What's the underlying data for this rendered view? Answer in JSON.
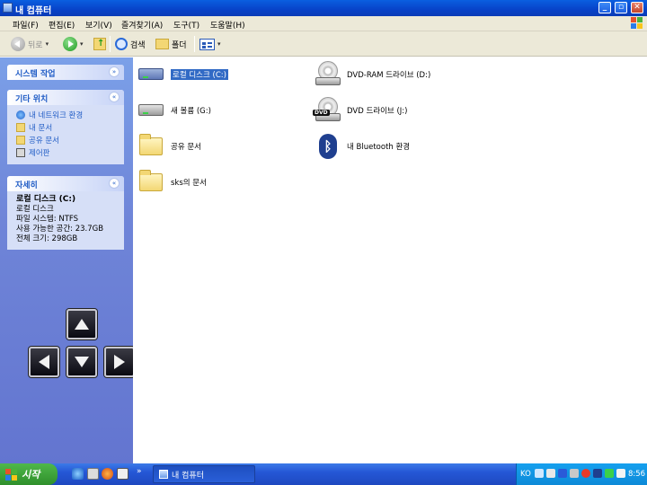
{
  "window": {
    "title": "내 컴퓨터"
  },
  "menu": [
    "파일(F)",
    "편집(E)",
    "보기(V)",
    "즐겨찾기(A)",
    "도구(T)",
    "도움말(H)"
  ],
  "toolbar": {
    "back": "뒤로",
    "search": "검색",
    "folders": "폴더"
  },
  "left_panel": {
    "system_tasks": {
      "title": "시스템 작업"
    },
    "other_places": {
      "title": "기타 위치",
      "links": [
        "내 네트워크 환경",
        "내 문서",
        "공유 문서",
        "제어판"
      ]
    },
    "details": {
      "title": "자세히",
      "name": "로컬 디스크 (C:)",
      "type": "로컬 디스크",
      "fs": "파일 시스템: NTFS",
      "free": "사용 가능한 공간: 23.7GB",
      "total": "전체 크기: 298GB"
    }
  },
  "items": [
    {
      "label": "로컬 디스크 (C:)",
      "icon": "hard-drive-icon",
      "selected": true
    },
    {
      "label": "DVD-RAM 드라이브 (D:)",
      "icon": "dvd-ram-drive-icon"
    },
    {
      "label": "새 볼륨 (G:)",
      "icon": "hard-drive-icon"
    },
    {
      "label": "DVD 드라이브 (J:)",
      "icon": "dvd-drive-icon"
    },
    {
      "label": "공유 문서",
      "icon": "folder-icon"
    },
    {
      "label": "내 Bluetooth 환경",
      "icon": "bluetooth-icon"
    },
    {
      "label": "sks의 문서",
      "icon": "folder-icon"
    }
  ],
  "taskbar": {
    "start": "시작",
    "task": "내 컴퓨터",
    "tray_lang": "KO",
    "clock": "8:56",
    "overflow": "»"
  }
}
